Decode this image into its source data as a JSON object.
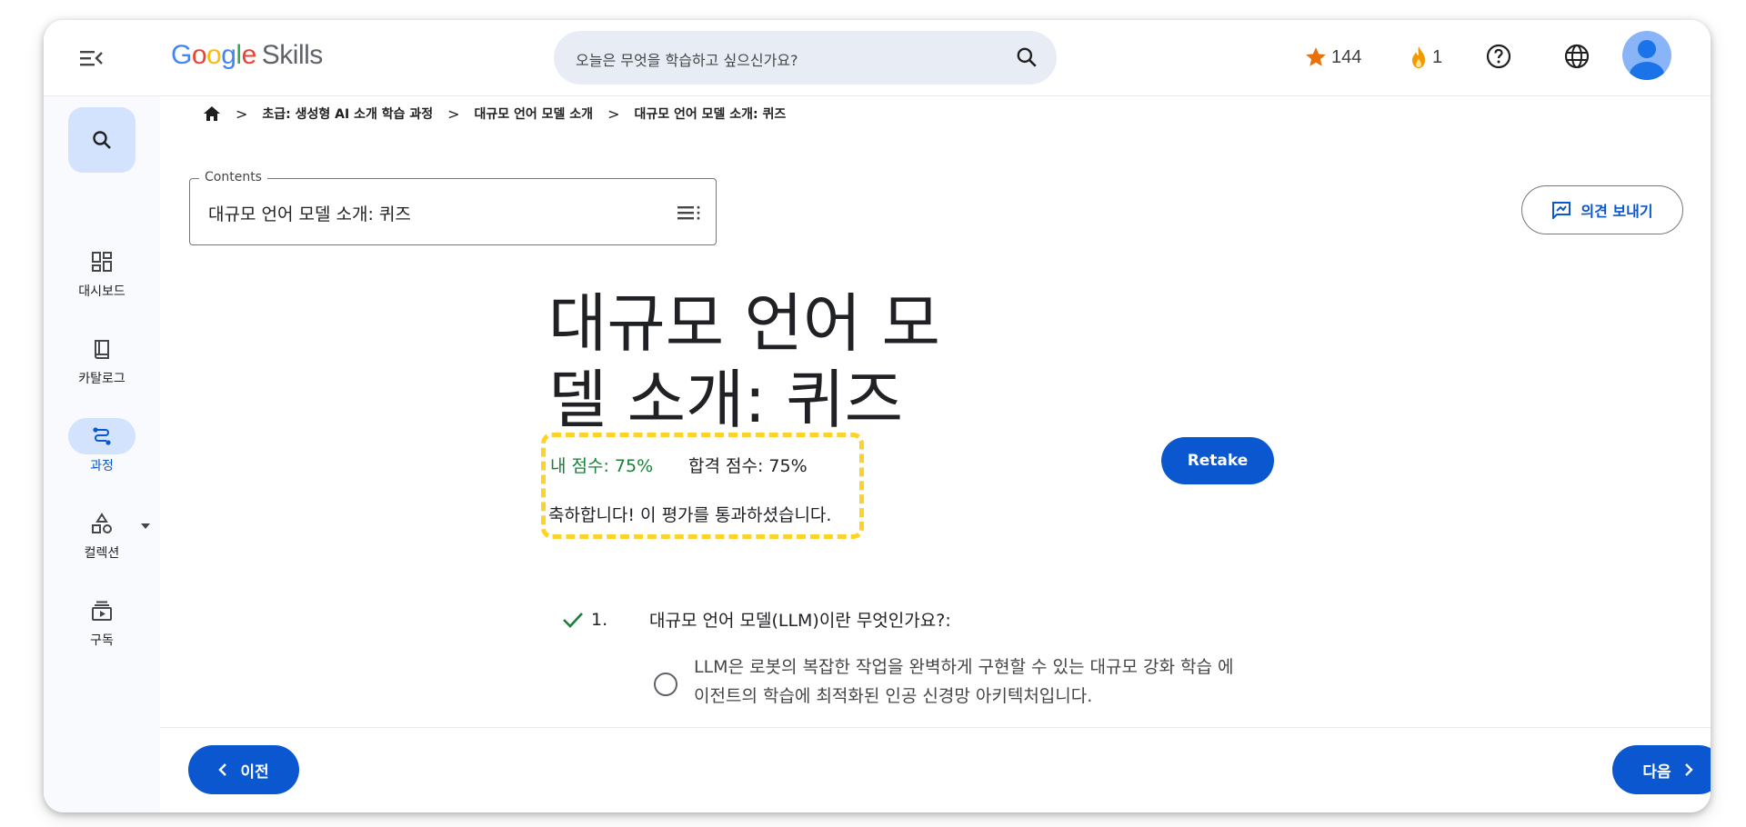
{
  "header": {
    "logo_google": "Google",
    "logo_skills": "Skills",
    "search_placeholder": "오늘은 무엇을 학습하고 싶으신가요?",
    "stars": "144",
    "streak": "1"
  },
  "sidebar": {
    "items": [
      {
        "label": "대시보드",
        "icon": "dashboard-icon"
      },
      {
        "label": "카탈로그",
        "icon": "book-icon"
      },
      {
        "label": "과정",
        "icon": "route-icon"
      },
      {
        "label": "컬렉션",
        "icon": "shapes-icon"
      },
      {
        "label": "구독",
        "icon": "subscriptions-icon"
      }
    ]
  },
  "breadcrumb": [
    "초급: 생성형 AI 소개 학습 과정",
    "대규모 언어 모델 소개",
    "대규모 언어 모델 소개: 퀴즈"
  ],
  "contents": {
    "legend": "Contents",
    "value": "대규모 언어 모델 소개: 퀴즈"
  },
  "feedback_label": "의견 보내기",
  "title": "대규모 언어 모델 소개: 퀴즈",
  "result": {
    "my_score": "내 점수: 75%",
    "passing_score": "합격 점수: 75%",
    "message": "축하합니다! 이 평가를 통과하셨습니다."
  },
  "retake_label": "Retake",
  "question": {
    "number": "1.",
    "text": "대규모 언어 모델(LLM)이란 무엇인가요?:",
    "options": [
      "LLM은 로봇의 복잡한 작업을 완벽하게 구현할 수 있는 대규모 강화 학습 에이전트의 학습에 최적화된 인공 신경망 아키텍처입니다."
    ]
  },
  "footer": {
    "prev_label": "이전",
    "next_label": "다음"
  },
  "colors": {
    "accent": "#0b57d0",
    "score_green": "#188038",
    "highlight_yellow": "#fdd22b"
  }
}
